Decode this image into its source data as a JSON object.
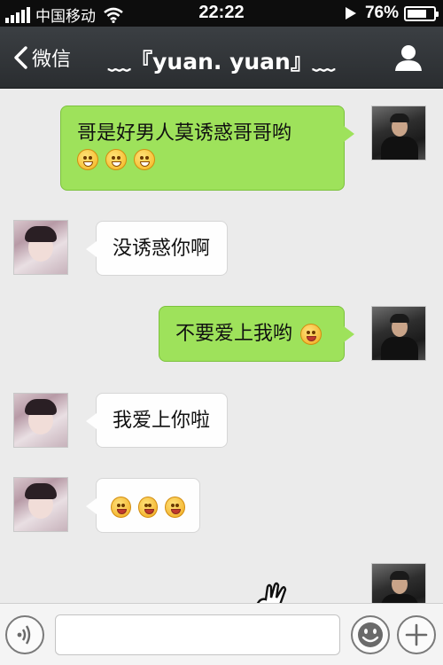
{
  "status_bar": {
    "carrier": "中国移动",
    "time": "22:22",
    "battery": "76%",
    "battery_level": 0.76
  },
  "nav": {
    "back_label": "微信",
    "title": "﹏『yuan. yuan』﹏"
  },
  "messages": [
    {
      "side": "right",
      "text": "哥是好男人莫诱惑哥哥哟",
      "emojis": [
        "grin-emoji",
        "grin-emoji",
        "grin-emoji"
      ]
    },
    {
      "side": "left",
      "text": "没诱惑你啊"
    },
    {
      "side": "right",
      "text": "不要爱上我哟",
      "emojis": [
        "shy-emoji"
      ]
    },
    {
      "side": "left",
      "text": "我爱上你啦"
    },
    {
      "side": "left",
      "text": "",
      "emojis": [
        "blush-emoji",
        "blush-emoji",
        "blush-emoji"
      ]
    }
  ],
  "input": {
    "value": ""
  },
  "icons": {
    "signal": "signal-bars-icon",
    "wifi": "wifi-icon",
    "play": "play-icon",
    "battery": "battery-icon",
    "back": "chevron-left-icon",
    "profile": "person-icon",
    "voice": "voice-icon",
    "emoji": "smiley-icon",
    "more": "plus-icon"
  },
  "colors": {
    "sent_bubble": "#9ee25b",
    "received_bubble": "#fefefe",
    "navbar": "#2f3236",
    "chat_background": "#ebebeb"
  }
}
